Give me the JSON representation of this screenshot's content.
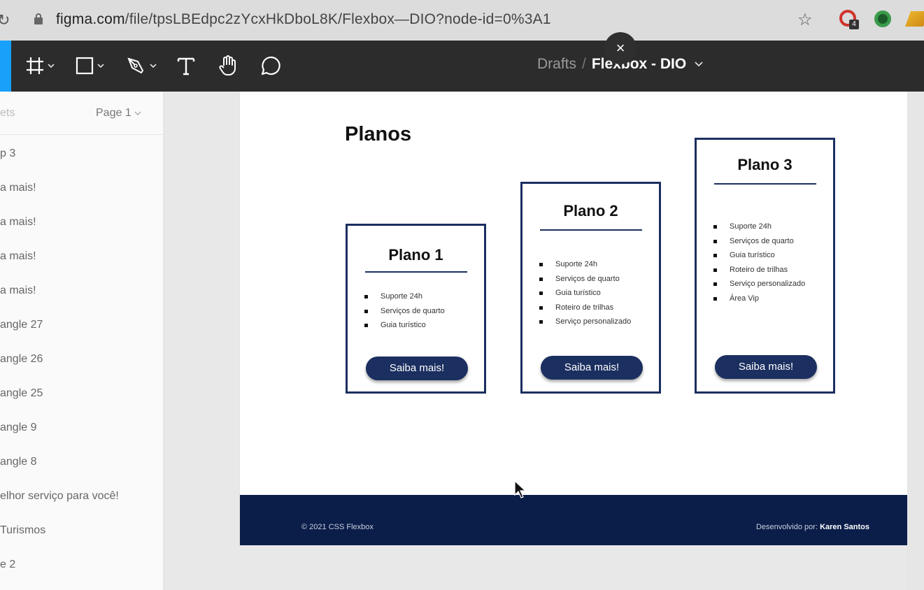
{
  "browser": {
    "url_host": "figma.com",
    "url_path": "/file/tpsLBEdpc2zYcxHkDboL8K/Flexbox—DIO?node-id=0%3A1",
    "extension_badge": "4"
  },
  "toolbar": {
    "tools": [
      "frame-tool",
      "rectangle-tool",
      "pen-tool",
      "text-tool",
      "hand-tool",
      "comment-tool"
    ],
    "breadcrumb_parent": "Drafts",
    "breadcrumb_separator": "/",
    "file_name": "Flexbox - DIO"
  },
  "close_label": "×",
  "panel": {
    "tab_label": "ets",
    "page_label": "Page 1",
    "layers": [
      "p 3",
      "a mais!",
      "a mais!",
      "a mais!",
      "a mais!",
      "angle 27",
      "angle 26",
      "angle 25",
      "angle 9",
      "angle 8",
      "elhor serviço para você!",
      "Turismos",
      "e 2"
    ]
  },
  "design": {
    "section_title": "Planos",
    "cards": [
      {
        "title": "Plano 1",
        "features": [
          "Suporte 24h",
          "Serviços de quarto",
          "Guia turístico"
        ],
        "button": "Saiba mais!"
      },
      {
        "title": "Plano 2",
        "features": [
          "Suporte 24h",
          "Serviços de quarto",
          "Guia turístico",
          "Roteiro de trilhas",
          "Serviço personalizado"
        ],
        "button": "Saiba mais!"
      },
      {
        "title": "Plano 3",
        "features": [
          "Suporte 24h",
          "Serviços de quarto",
          "Guia turístico",
          "Roteiro de trilhas",
          "Serviço personalizado",
          "Área Vip"
        ],
        "button": "Saiba mais!"
      }
    ],
    "footer": {
      "copyright": "© 2021 CSS Flexbox",
      "developed_by_label": "Desenvolvido por:",
      "developer": "Karen Santos"
    }
  },
  "colors": {
    "navy": "#1b2f60",
    "footer_bg": "#0b1e4a",
    "toolbar_bg": "#2c2c2c",
    "figma_blue": "#18a0fb"
  }
}
